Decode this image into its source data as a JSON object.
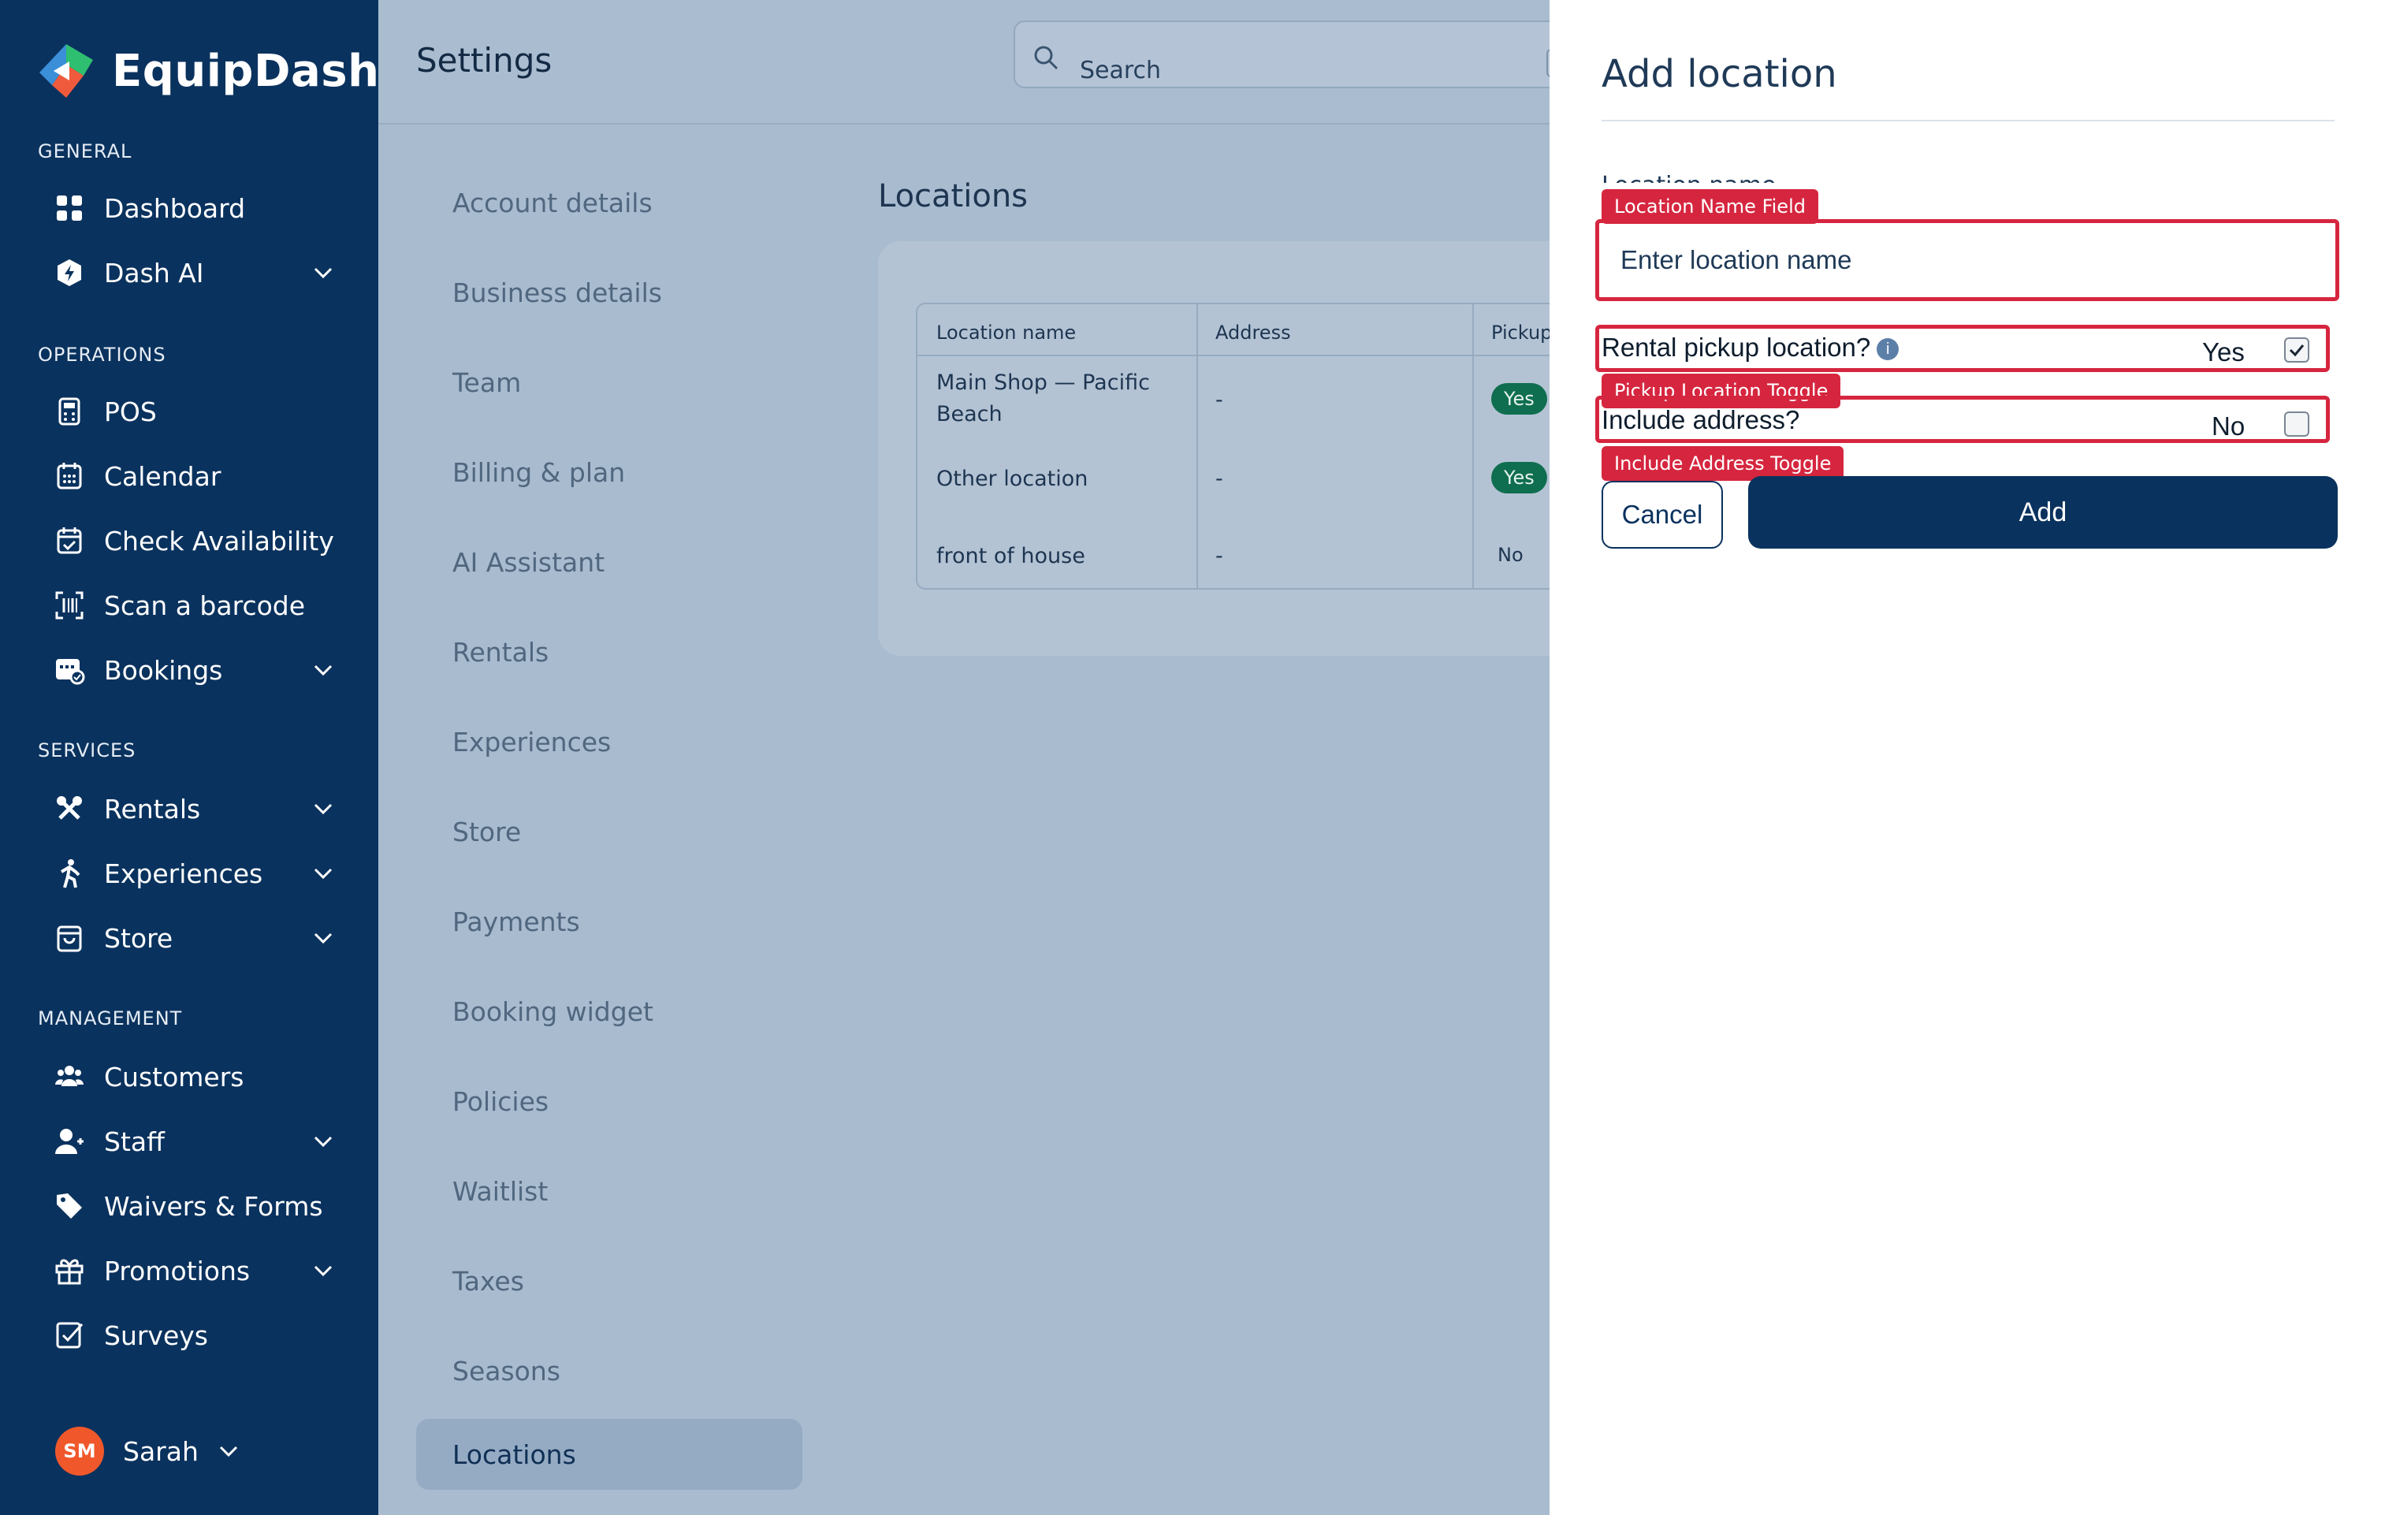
{
  "app": {
    "name": "EquipDash"
  },
  "colors": {
    "sidebar": "#0a325e",
    "accent": "#0a325e",
    "annotation": "#d6263f",
    "badge": "#0f6e4f",
    "avatar": "#f0582b"
  },
  "sidebar": {
    "sections": [
      {
        "label": "GENERAL"
      },
      {
        "label": "OPERATIONS"
      },
      {
        "label": "SERVICES"
      },
      {
        "label": "MANAGEMENT"
      }
    ],
    "items": [
      {
        "label": "Dashboard",
        "icon": "grid-icon"
      },
      {
        "label": "Dash AI",
        "icon": "ai-icon"
      },
      {
        "label": "POS",
        "icon": "pos-icon"
      },
      {
        "label": "Calendar",
        "icon": "calendar-icon"
      },
      {
        "label": "Check Availability",
        "icon": "calendar-check-icon"
      },
      {
        "label": "Scan a barcode",
        "icon": "barcode-icon"
      },
      {
        "label": "Bookings",
        "icon": "bookings-icon"
      },
      {
        "label": "Rentals",
        "icon": "rentals-icon"
      },
      {
        "label": "Experiences",
        "icon": "experiences-icon"
      },
      {
        "label": "Store",
        "icon": "store-icon"
      },
      {
        "label": "Customers",
        "icon": "customers-icon"
      },
      {
        "label": "Staff",
        "icon": "staff-icon"
      },
      {
        "label": "Waivers & Forms",
        "icon": "tag-icon"
      },
      {
        "label": "Promotions",
        "icon": "gift-icon"
      },
      {
        "label": "Surveys",
        "icon": "survey-icon"
      }
    ],
    "user": {
      "initials": "SM",
      "name": "Sarah"
    }
  },
  "header": {
    "title": "Settings",
    "search_placeholder": "Search"
  },
  "settings_nav": {
    "items": [
      "Account details",
      "Business details",
      "Team",
      "Billing & plan",
      "AI Assistant",
      "Rentals",
      "Experiences",
      "Store",
      "Payments",
      "Booking widget",
      "Policies",
      "Waitlist",
      "Taxes",
      "Seasons",
      "Locations"
    ],
    "active": "Locations"
  },
  "locations": {
    "title": "Locations",
    "columns": [
      "Location name",
      "Address",
      "Pickup"
    ],
    "rows": [
      {
        "name_line1": "Main Shop — Pacific",
        "name_line2": "Beach",
        "address": "-",
        "pickup": "Yes"
      },
      {
        "name_line1": "Other location",
        "address": "-",
        "pickup": "Yes"
      },
      {
        "name_line1": "front of house",
        "address": "-",
        "pickup": "No"
      }
    ]
  },
  "drawer": {
    "title": "Add location",
    "name_label": "Location name",
    "name_placeholder": "Enter location name",
    "pickup_label": "Rental pickup location?",
    "pickup_value": "Yes",
    "pickup_checked": true,
    "address_label": "Include address?",
    "address_value": "No",
    "address_checked": false,
    "cancel_label": "Cancel",
    "add_label": "Add"
  },
  "annotations": {
    "name_field": "Location Name Field",
    "pickup_toggle": "Pickup Location Toggle",
    "address_toggle": "Include Address Toggle"
  }
}
